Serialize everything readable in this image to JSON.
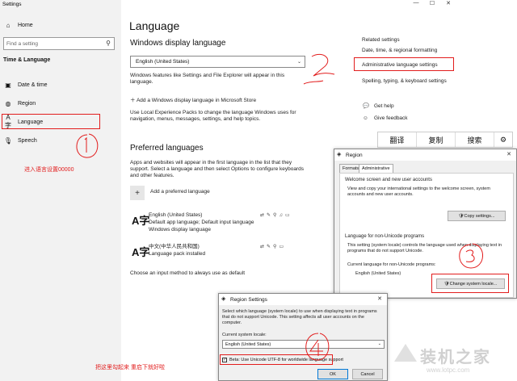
{
  "window": {
    "title": "Settings",
    "controls": [
      "—",
      "☐",
      "✕"
    ]
  },
  "sidebar": {
    "home": "Home",
    "search_placeholder": "Find a setting",
    "section": "Time & Language",
    "items": [
      {
        "label": "Date & time",
        "icon": "calendar-icon"
      },
      {
        "label": "Region",
        "icon": "globe-icon"
      },
      {
        "label": "Language",
        "icon": "language-icon"
      },
      {
        "label": "Speech",
        "icon": "microphone-icon"
      }
    ]
  },
  "main": {
    "title": "Language",
    "display_heading": "Windows display language",
    "display_value": "English (United States)",
    "display_desc": "Windows features like Settings and File Explorer will appear in this language.",
    "add_display_link": "Add a Windows display language in Microsoft Store",
    "lep_desc": "Use Local Experience Packs to change the language Windows uses for navigation, menus, messages, settings, and help topics.",
    "preferred_heading": "Preferred languages",
    "preferred_desc": "Apps and websites will appear in the first language in the list that they support. Select a language and then select Options to configure keyboards and other features.",
    "add_pref": "Add a preferred language",
    "languages": [
      {
        "name": "English (United States)",
        "line1": "Default app language; Default input language",
        "line2": "Windows display language"
      },
      {
        "name": "中文(中华人民共和国)",
        "line1": "Language pack installed",
        "line2": ""
      }
    ],
    "input_method_link": "Choose an input method to always use as default"
  },
  "related": {
    "heading": "Related settings",
    "links": [
      "Date, time, & regional formatting",
      "Administrative language settings",
      "Spelling, typing, & keyboard settings"
    ],
    "help": "Get help",
    "feedback": "Give feedback"
  },
  "toolbar": {
    "translate": "翻译",
    "copy": "复制",
    "search": "搜索",
    "settings_icon": "gear-icon"
  },
  "region_dialog": {
    "title": "Region",
    "tabs": [
      "Formats",
      "Administrative"
    ],
    "welcome_heading": "Welcome screen and new user accounts",
    "welcome_desc": "View and copy your international settings to the welcome screen, system accounts and new user accounts.",
    "copy_btn": "Copy settings...",
    "nonunicode_heading": "Language for non-Unicode programs",
    "nonunicode_desc": "This setting (system locale) controls the language used when displaying text in programs that do not support Unicode.",
    "current_label": "Current language for non-Unicode programs:",
    "current_value": "English (United States)",
    "change_btn": "Change system locale..."
  },
  "region_settings": {
    "title": "Region Settings",
    "desc": "Select which language (system locale) to use when displaying text in programs that do not support Unicode. This setting affects all user accounts on the computer.",
    "current_label": "Current system locale:",
    "current_value": "English (United States)",
    "beta_label": "Beta: Use Unicode UTF-8 for worldwide language support",
    "ok": "OK",
    "cancel": "Cancel"
  },
  "annotations": {
    "step1_note": "进入语言设置00000",
    "step4_note": "把这里勾起来 重启下就好啦",
    "watermark": "装机之家",
    "watermark_url": "www.lotpc.com"
  }
}
